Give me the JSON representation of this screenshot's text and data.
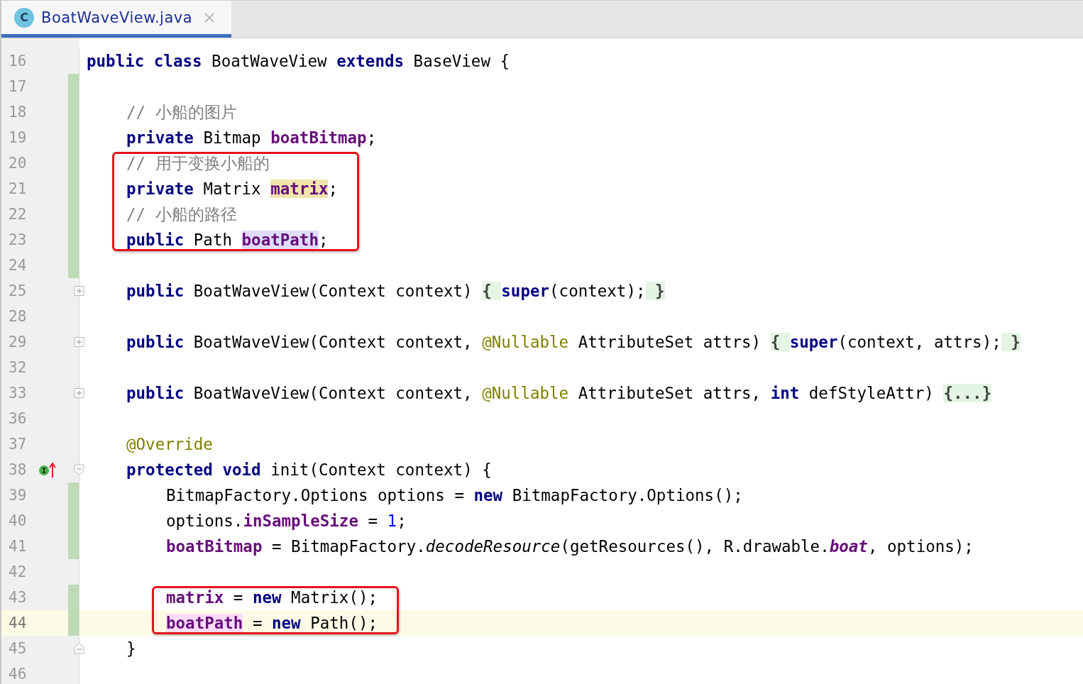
{
  "tab": {
    "icon_letter": "C",
    "label": "BoatWaveView.java",
    "selected": true
  },
  "lines": [
    {
      "number": "16",
      "changed": false,
      "current": false,
      "boxed": false,
      "tokens": [
        {
          "text": "public class ",
          "kind": "keyword"
        },
        {
          "text": "BoatWaveView ",
          "kind": "plain"
        },
        {
          "text": "extends ",
          "kind": "keyword"
        },
        {
          "text": "BaseView {",
          "kind": "plain"
        }
      ],
      "children": [
        {
          "number": "17",
          "changed": true,
          "current": false,
          "boxed": false
        },
        {
          "number": "18",
          "changed": true,
          "current": false,
          "boxed": false,
          "tokens": [
            {
              "text": "// 小船的图片",
              "kind": "comment"
            }
          ]
        },
        {
          "number": "19",
          "changed": true,
          "current": false,
          "boxed": false,
          "tokens": [
            {
              "text": "private ",
              "kind": "keyword"
            },
            {
              "text": "Bitmap ",
              "kind": "plain"
            },
            {
              "text": "boatBitmap",
              "kind": "field"
            },
            {
              "text": ";",
              "kind": "plain"
            }
          ]
        },
        {
          "number": "20",
          "changed": true,
          "current": false,
          "boxed": true,
          "tokens": [
            {
              "text": "// 用于变换小船的",
              "kind": "comment"
            }
          ]
        },
        {
          "number": "21",
          "changed": true,
          "current": false,
          "boxed": true,
          "tokens": [
            {
              "text": "private ",
              "kind": "keyword"
            },
            {
              "text": "Matrix ",
              "kind": "plain"
            },
            {
              "text": "matrix",
              "kind": "field_unused_highlight"
            },
            {
              "text": ";",
              "kind": "plain"
            }
          ]
        },
        {
          "number": "22",
          "changed": true,
          "current": false,
          "boxed": true,
          "tokens": [
            {
              "text": "// 小船的路径",
              "kind": "comment"
            }
          ]
        },
        {
          "number": "23",
          "changed": true,
          "current": false,
          "boxed": true,
          "tokens": [
            {
              "text": "public ",
              "kind": "keyword"
            },
            {
              "text": "Path ",
              "kind": "plain"
            },
            {
              "text": "boatPath",
              "kind": "field_declaration_highlight"
            },
            {
              "text": ";",
              "kind": "plain"
            }
          ]
        },
        {
          "number": "24",
          "changed": true,
          "current": false,
          "boxed": false
        },
        {
          "number": "25",
          "changed": false,
          "current": false,
          "boxed": false,
          "fold": {
            "kind": "collapsed"
          },
          "tokens": [
            {
              "text": "public ",
              "kind": "keyword"
            },
            {
              "text": "BoatWaveView(Context context) ",
              "kind": "plain"
            },
            {
              "text": "{ ",
              "kind": "folded"
            },
            {
              "text": "super",
              "kind": "keyword"
            },
            {
              "text": "(context);",
              "kind": "plain"
            },
            {
              "text": " }",
              "kind": "folded"
            }
          ]
        },
        {
          "number": "28",
          "changed": false,
          "current": false,
          "boxed": false
        },
        {
          "number": "29",
          "changed": false,
          "current": false,
          "boxed": false,
          "fold": {
            "kind": "collapsed"
          },
          "tokens": [
            {
              "text": "public ",
              "kind": "keyword"
            },
            {
              "text": "BoatWaveView(Context context, ",
              "kind": "plain"
            },
            {
              "text": "@Nullable ",
              "kind": "annotation"
            },
            {
              "text": "AttributeSet attrs) ",
              "kind": "plain"
            },
            {
              "text": "{ ",
              "kind": "folded"
            },
            {
              "text": "super",
              "kind": "keyword"
            },
            {
              "text": "(context, attrs);",
              "kind": "plain"
            },
            {
              "text": " }",
              "kind": "folded"
            }
          ]
        },
        {
          "number": "32",
          "changed": false,
          "current": false,
          "boxed": false
        },
        {
          "number": "33",
          "changed": false,
          "current": false,
          "boxed": false,
          "fold": {
            "kind": "collapsed"
          },
          "tokens": [
            {
              "text": "public ",
              "kind": "keyword"
            },
            {
              "text": "BoatWaveView(Context context, ",
              "kind": "plain"
            },
            {
              "text": "@Nullable ",
              "kind": "annotation"
            },
            {
              "text": "AttributeSet attrs, ",
              "kind": "plain"
            },
            {
              "text": "int ",
              "kind": "keyword"
            },
            {
              "text": "defStyleAttr) ",
              "kind": "plain"
            },
            {
              "text": "{...}",
              "kind": "folded"
            }
          ]
        },
        {
          "number": "36",
          "changed": false,
          "current": false,
          "boxed": false
        },
        {
          "number": "37",
          "changed": false,
          "current": false,
          "boxed": false,
          "tokens": [
            {
              "text": "@Override",
              "kind": "annotation"
            }
          ]
        },
        {
          "number": "38",
          "changed": false,
          "current": false,
          "boxed": false,
          "fold": {
            "kind": "start"
          },
          "gutter_icon": {
            "kind": "implements"
          },
          "tokens": [
            {
              "text": "protected void ",
              "kind": "keyword"
            },
            {
              "text": "init(Context context) {",
              "kind": "plain"
            }
          ],
          "children": [
            {
              "number": "39",
              "changed": true,
              "current": false,
              "boxed": false,
              "tokens": [
                {
                  "text": "BitmapFactory.Options options = ",
                  "kind": "plain"
                },
                {
                  "text": "new ",
                  "kind": "keyword"
                },
                {
                  "text": "BitmapFactory.Options();",
                  "kind": "plain"
                }
              ]
            },
            {
              "number": "40",
              "changed": true,
              "current": false,
              "boxed": false,
              "tokens": [
                {
                  "text": "options.",
                  "kind": "plain"
                },
                {
                  "text": "inSampleSize",
                  "kind": "field"
                },
                {
                  "text": " = ",
                  "kind": "plain"
                },
                {
                  "text": "1",
                  "kind": "number"
                },
                {
                  "text": ";",
                  "kind": "plain"
                }
              ]
            },
            {
              "number": "41",
              "changed": true,
              "current": false,
              "boxed": false,
              "tokens": [
                {
                  "text": "boatBitmap",
                  "kind": "field"
                },
                {
                  "text": " = BitmapFactory.",
                  "kind": "plain"
                },
                {
                  "text": "decodeResource",
                  "kind": "static_method"
                },
                {
                  "text": "(getResources(), R.drawable.",
                  "kind": "plain"
                },
                {
                  "text": "boat",
                  "kind": "static_field"
                },
                {
                  "text": ", options);",
                  "kind": "plain"
                }
              ]
            },
            {
              "number": "42",
              "changed": false,
              "current": false,
              "boxed": false
            },
            {
              "number": "43",
              "changed": true,
              "current": false,
              "boxed": true,
              "tokens": [
                {
                  "text": "matrix",
                  "kind": "field"
                },
                {
                  "text": " = ",
                  "kind": "plain"
                },
                {
                  "text": "new ",
                  "kind": "keyword"
                },
                {
                  "text": "Matrix();",
                  "kind": "plain"
                }
              ]
            },
            {
              "number": "44",
              "changed": true,
              "current": true,
              "boxed": true,
              "tokens": [
                {
                  "text": "boatPath",
                  "kind": "field_write_highlight"
                },
                {
                  "text": " = ",
                  "kind": "plain"
                },
                {
                  "text": "new ",
                  "kind": "keyword"
                },
                {
                  "text": "Path();",
                  "kind": "plain"
                }
              ]
            }
          ]
        },
        {
          "number": "45",
          "changed": false,
          "current": false,
          "boxed": false,
          "fold": {
            "kind": "end"
          },
          "tokens": [
            {
              "text": "}",
              "kind": "plain"
            }
          ]
        }
      ]
    },
    {
      "number": "46",
      "changed": false,
      "current": false,
      "boxed": false
    }
  ]
}
